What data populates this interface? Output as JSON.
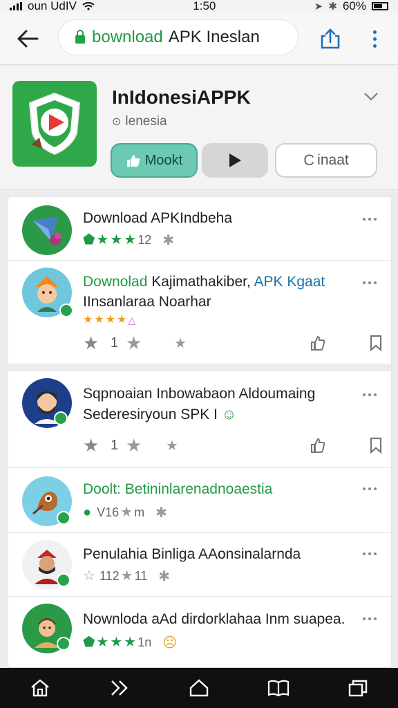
{
  "status_bar": {
    "carrier": "oun UdIV",
    "time": "1:50",
    "battery": "60%"
  },
  "url_bar": {
    "url_green": "bownload",
    "url_dark": "APK Ineslan"
  },
  "app": {
    "title": "InIdonesiAPPK",
    "subtitle": "lenesia",
    "primary_button": "Mookt",
    "secondary_button": "inaat",
    "brand_color": "#2fa84a"
  },
  "items": [
    {
      "title": "Download APKIndbeha",
      "meta": "12"
    },
    {
      "title_green": "Downolad",
      "title_dark": "Kajimathakiber,",
      "title_blue": "APK Kgaat",
      "line2": "IInsanlaraa Noarhar",
      "count": "1"
    },
    {
      "line1": "Sqpnoaian Inbowabaon Aldoumaing",
      "line2": "Sederesiryoun SPK I",
      "count": "1"
    },
    {
      "title": "Doolt: Betininlarenadnoaestia",
      "meta": "V16",
      "meta2": "m"
    },
    {
      "title": "Penulahia Binliga AAonsinalarnda",
      "meta": "112",
      "meta2": "11"
    },
    {
      "title": "Nownloda aAd dirdorklahaa Inm suapea.",
      "meta": "1n"
    }
  ]
}
